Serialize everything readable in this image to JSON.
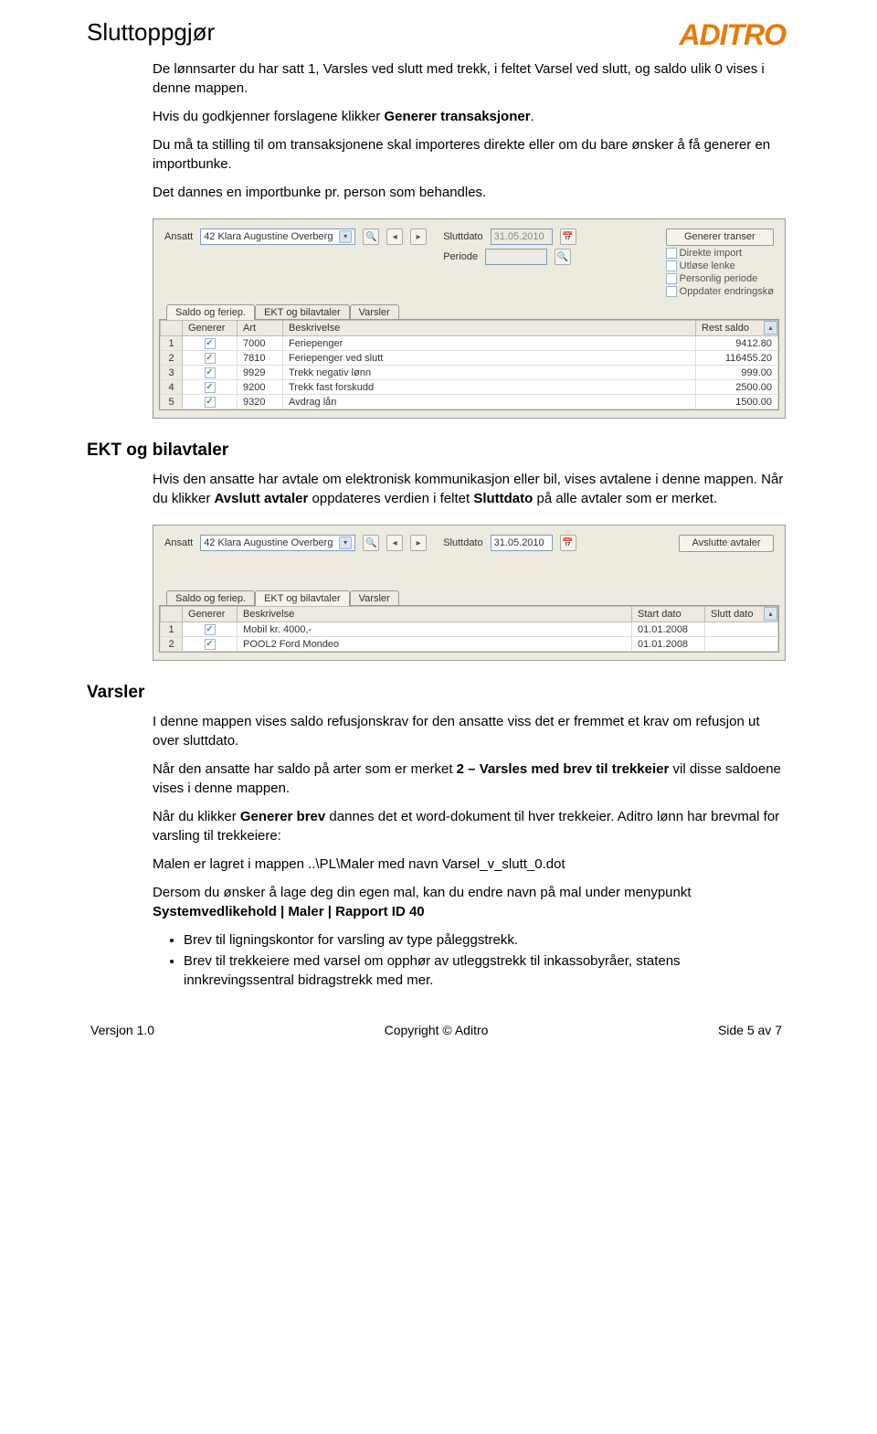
{
  "header": {
    "title": "Sluttoppgjør",
    "logo": "ADITRO"
  },
  "text": {
    "intro1": "De lønnsarter du har satt 1, Varsles ved slutt med trekk, i feltet Varsel ved slutt, og saldo ulik 0 vises i denne mappen.",
    "intro2_a": "Hvis du godkjenner forslagene klikker ",
    "intro2_b": "Generer transaksjoner",
    "intro2_c": ".",
    "intro3": "Du må ta stilling til om transaksjonene skal importeres direkte eller om du bare ønsker å få generer en importbunke.",
    "intro4": "Det dannes en importbunke pr. person som behandles."
  },
  "panel1": {
    "labels": {
      "ansatt": "Ansatt",
      "sluttdato": "Sluttdato",
      "periode": "Periode"
    },
    "ansatt_value": "42 Klara Augustine Overberg",
    "sluttdato_value": "31.05.2010",
    "periode_value": "",
    "buttons": {
      "generer_transer": "Generer transer"
    },
    "checks": {
      "direkte_import": "Direkte import",
      "utlose_lenke": "Utløse lenke",
      "personlig_periode": "Personlig periode",
      "oppdater_endringsko": "Oppdater endringskø"
    },
    "tabs": [
      "Saldo og feriep.",
      "EKT og bilavtaler",
      "Varsler"
    ],
    "active_tab": 0,
    "grid": {
      "cols": [
        "",
        "Generer",
        "Art",
        "Beskrivelse",
        "Rest saldo"
      ],
      "rows": [
        {
          "n": "1",
          "chk": true,
          "art": "7000",
          "beskr": "Feriepenger",
          "saldo": "9412.80"
        },
        {
          "n": "2",
          "chk": true,
          "art": "7810",
          "beskr": "Feriepenger ved slutt",
          "saldo": "116455.20"
        },
        {
          "n": "3",
          "chk": true,
          "art": "9929",
          "beskr": "Trekk negativ lønn",
          "saldo": "999.00"
        },
        {
          "n": "4",
          "chk": true,
          "art": "9200",
          "beskr": "Trekk fast forskudd",
          "saldo": "2500.00"
        },
        {
          "n": "5",
          "chk": true,
          "art": "9320",
          "beskr": "Avdrag lån",
          "saldo": "1500.00"
        }
      ]
    }
  },
  "section_ekt": {
    "heading": "EKT og bilavtaler",
    "p1_a": "Hvis den ansatte har avtale om elektronisk kommunikasjon eller bil, vises avtalene i denne mappen. Når du klikker ",
    "p1_b": "Avslutt avtaler",
    "p1_c": " oppdateres verdien i feltet ",
    "p1_d": "Sluttdato",
    "p1_e": " på alle avtaler som er merket."
  },
  "panel2": {
    "labels": {
      "ansatt": "Ansatt",
      "sluttdato": "Sluttdato"
    },
    "ansatt_value": "42 Klara Augustine Overberg",
    "sluttdato_value": "31.05.2010",
    "buttons": {
      "avslutte_avtaler": "Avslutte avtaler"
    },
    "tabs": [
      "Saldo og feriep.",
      "EKT og bilavtaler",
      "Varsler"
    ],
    "active_tab": 1,
    "grid": {
      "cols": [
        "",
        "Generer",
        "Beskrivelse",
        "Start dato",
        "Slutt dato"
      ],
      "rows": [
        {
          "n": "1",
          "chk": true,
          "beskr": "Mobil kr. 4000,-",
          "start": "01.01.2008",
          "slutt": ""
        },
        {
          "n": "2",
          "chk": true,
          "beskr": "POOL2 Ford Mondeo",
          "start": "01.01.2008",
          "slutt": ""
        }
      ]
    }
  },
  "section_varsler": {
    "heading": "Varsler",
    "p1": "I denne mappen vises saldo refusjonskrav for den ansatte viss det er fremmet et krav om refusjon ut over sluttdato.",
    "p2_a": "Når den ansatte har saldo på arter som er merket ",
    "p2_b": "2 – Varsles med brev til trekkeier",
    "p2_c": " vil disse saldoene vises i denne mappen.",
    "p3_a": "Når du klikker ",
    "p3_b": "Generer brev",
    "p3_c": " dannes det et word-dokument til hver trekkeier. Aditro lønn har brevmal for varsling til trekkeiere:",
    "p4": "Malen er lagret i mappen ..\\PL\\Maler med navn Varsel_v_slutt_0.dot",
    "p5_a": "Dersom du ønsker å lage deg din egen mal, kan du endre navn på mal under menypunkt ",
    "p5_b": "Systemvedlikehold | Maler | Rapport ID 40",
    "bullets": [
      "Brev til ligningskontor for varsling av type påleggstrekk.",
      "Brev til trekkeiere med varsel om opphør av utleggstrekk til inkassobyråer, statens innkrevingssentral bidragstrekk med mer."
    ]
  },
  "footer": {
    "left": "Versjon 1.0",
    "center": "Copyright © Aditro",
    "right": "Side 5 av 7"
  }
}
